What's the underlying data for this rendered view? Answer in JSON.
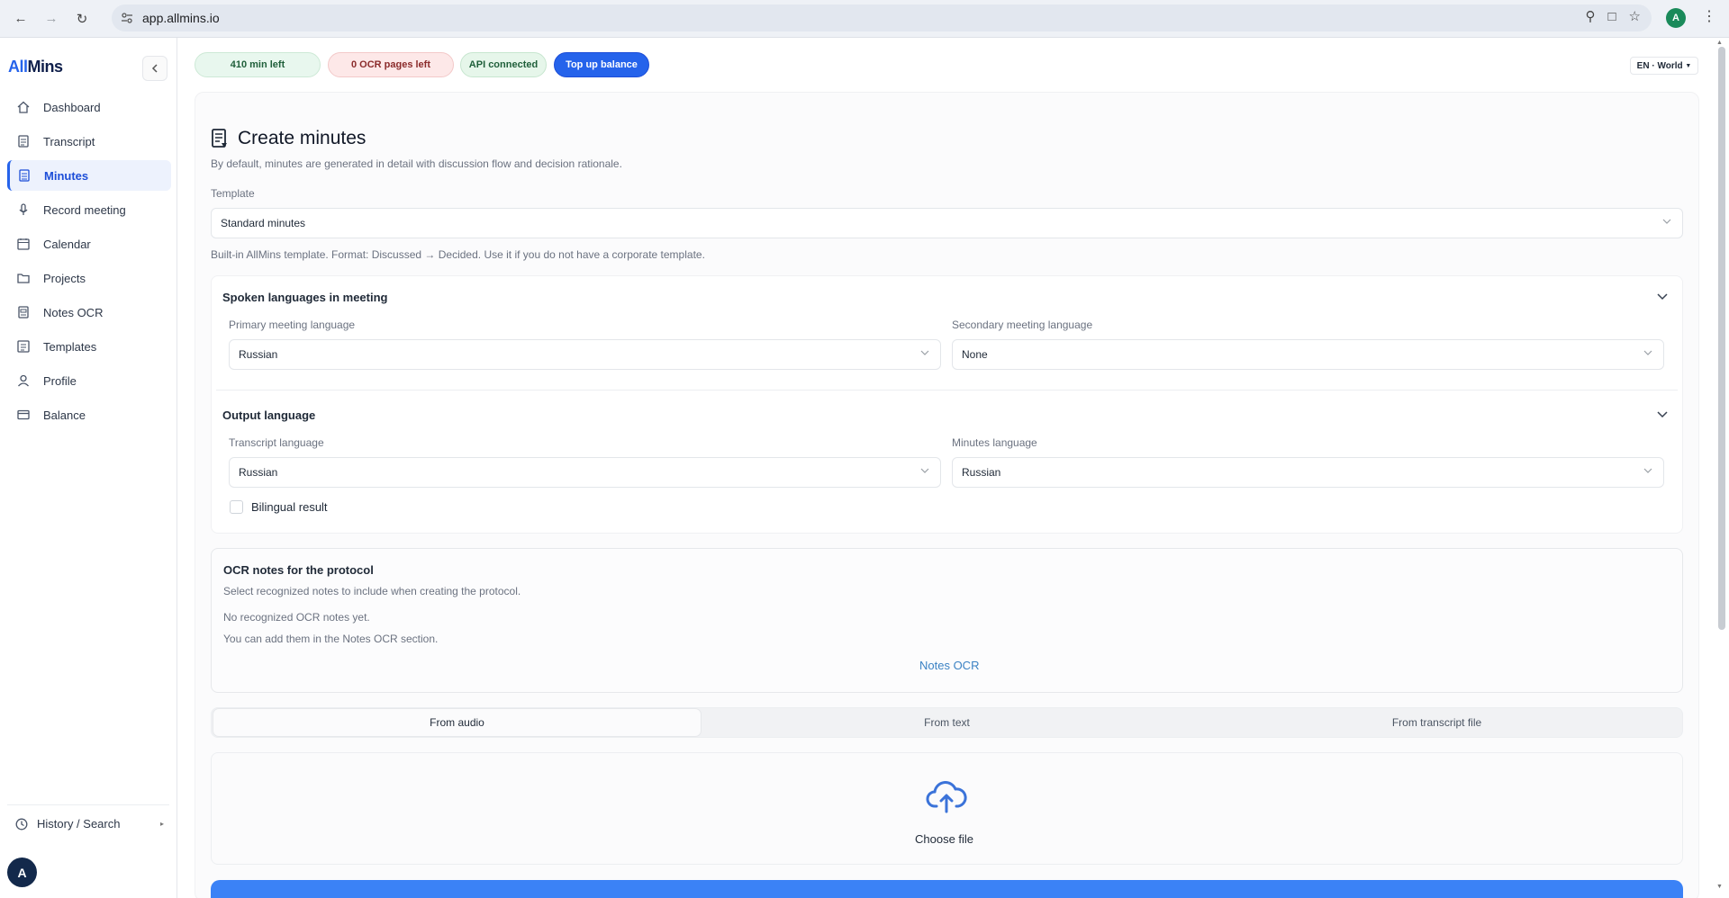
{
  "browser": {
    "url": "app.allmins.io",
    "profile_initial": "A"
  },
  "sidebar": {
    "logo_all": "All",
    "logo_mins": "Mins",
    "items": [
      {
        "label": "Dashboard",
        "icon": "home-icon"
      },
      {
        "label": "Transcript",
        "icon": "document-icon"
      },
      {
        "label": "Minutes",
        "icon": "minutes-icon",
        "active": true
      },
      {
        "label": "Record meeting",
        "icon": "microphone-icon"
      },
      {
        "label": "Calendar",
        "icon": "calendar-icon"
      },
      {
        "label": "Projects",
        "icon": "folder-icon"
      },
      {
        "label": "Notes OCR",
        "icon": "scan-icon"
      },
      {
        "label": "Templates",
        "icon": "list-icon"
      },
      {
        "label": "Profile",
        "icon": "user-icon"
      },
      {
        "label": "Balance",
        "icon": "card-icon"
      }
    ],
    "history_label": "History / Search",
    "avatar_initial": "A"
  },
  "status": {
    "minutes_left": "410 min left",
    "ocr_left": "0 OCR pages left",
    "api": "API connected",
    "topup": "Top up balance",
    "locale": "EN · World"
  },
  "page": {
    "title": "Create minutes",
    "subtitle": "By default, minutes are generated in detail with discussion flow and decision rationale.",
    "template_label": "Template",
    "template_value": "Standard minutes",
    "template_hint": "Built-in AllMins template. Format: Discussed → Decided. Use it if you do not have a corporate template."
  },
  "spoken": {
    "title": "Spoken languages in meeting",
    "primary_label": "Primary meeting language",
    "primary_value": "Russian",
    "secondary_label": "Secondary meeting language",
    "secondary_value": "None"
  },
  "output": {
    "title": "Output language",
    "transcript_label": "Transcript language",
    "transcript_value": "Russian",
    "minutes_label": "Minutes language",
    "minutes_value": "Russian",
    "bilingual_label": "Bilingual result"
  },
  "ocr": {
    "title": "OCR notes for the protocol",
    "description": "Select recognized notes to include when creating the protocol.",
    "empty": "No recognized OCR notes yet.",
    "hint": "You can add them in the Notes OCR section.",
    "link": "Notes OCR"
  },
  "source_tabs": [
    "From audio",
    "From text",
    "From transcript file"
  ],
  "upload": {
    "label": "Choose file"
  },
  "colors": {
    "accent": "#2563eb",
    "success_bg": "#e8f7ee",
    "danger_bg": "#fde8e8"
  }
}
